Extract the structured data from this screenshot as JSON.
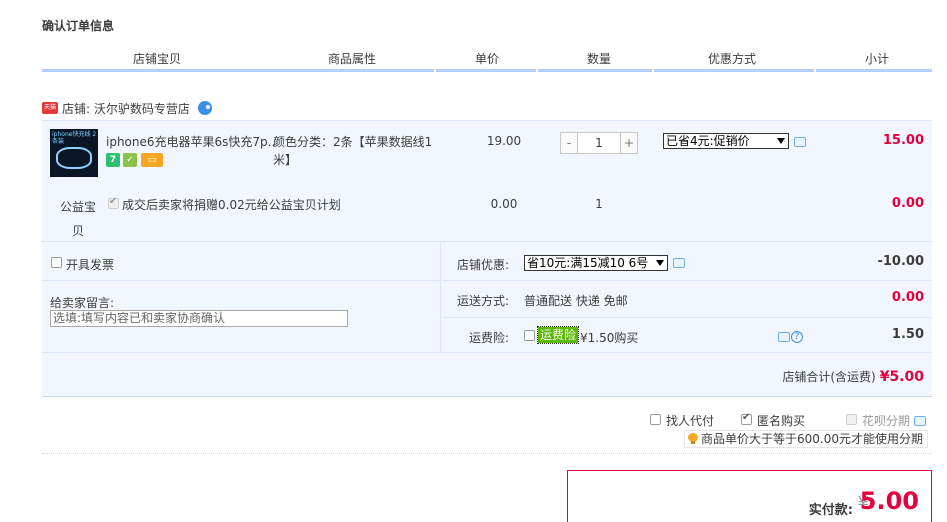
{
  "section_title": "确认订单信息",
  "columns": [
    "店铺宝贝",
    "商品属性",
    "单价",
    "数量",
    "优惠方式",
    "小计"
  ],
  "shop": {
    "badge": "天猫",
    "label": "店铺: 沃尔驴数码专营店"
  },
  "item": {
    "thumb_text": "iphone快充线 2条装",
    "name": "iphone6充电器苹果6s快充7p...",
    "attr_label": "颜色分类：2条【苹果数据线1米】",
    "price": "19.00",
    "quantity": "1",
    "minus": "-",
    "plus": "+",
    "discount_option": "已省4元:促销价",
    "subtotal": "15.00",
    "tag_seven": "7"
  },
  "charity": {
    "label": "公益宝贝",
    "text": "成交后卖家将捐赠0.02元给公益宝贝计划",
    "price": "0.00",
    "quantity": "1",
    "subtotal": "0.00"
  },
  "invoice_label": "开具发票",
  "shop_discount": {
    "label": "店铺优惠:",
    "option": "省10元:满15减10 6号",
    "amount": "-10.00"
  },
  "message": {
    "label": "给卖家留言:",
    "placeholder": "选填:填写内容已和卖家协商确认"
  },
  "shipping": {
    "label": "运送方式:",
    "value": "普通配送 快递 免邮",
    "amount": "0.00"
  },
  "freight_insurance": {
    "label": "运费险:",
    "tag": "运费险",
    "price_text": "¥1.50购买",
    "amount": "1.50"
  },
  "shop_total": {
    "label": "店铺合计(含运费)",
    "amount": "¥5.00"
  },
  "options": {
    "proxy_pay": "找人代付",
    "anonymous": "匿名购买",
    "huabei": "花呗分期"
  },
  "notice": "商品单价大于等于600.00元才能使用分期",
  "payment": {
    "label": "实付款:",
    "currency": "¥",
    "amount": "5.00"
  }
}
